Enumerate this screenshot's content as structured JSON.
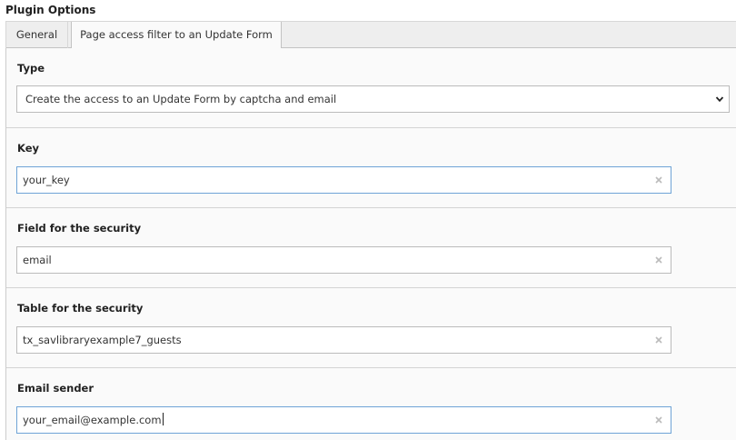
{
  "plugin": {
    "title": "Plugin Options"
  },
  "tabs": [
    {
      "label": "General",
      "active": false
    },
    {
      "label": "Page access filter to an Update Form",
      "active": true
    }
  ],
  "fields": {
    "type": {
      "label": "Type",
      "selected": "Create the access to an Update Form by captcha and email",
      "icon": "chevron-down-icon"
    },
    "key": {
      "label": "Key",
      "value": "your_key",
      "clear_icon": "close-icon"
    },
    "security_field": {
      "label": "Field for the security",
      "value": "email",
      "clear_icon": "close-icon"
    },
    "security_table": {
      "label": "Table for the security",
      "value": "tx_savlibraryexample7_guests",
      "clear_icon": "close-icon"
    },
    "email_sender": {
      "label": "Email sender",
      "value": "your_email@example.com",
      "clear_icon": "close-icon",
      "focused": true
    }
  },
  "colors": {
    "panel_background": "#fafafa",
    "focus_border": "#6fa3d6",
    "clear_icon": "#bbbbbb"
  }
}
